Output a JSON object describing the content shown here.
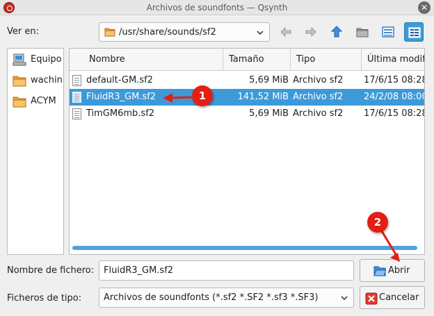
{
  "window": {
    "title": "Archivos de soundfonts — Qsynth",
    "close_glyph": "✕"
  },
  "look_in": {
    "label": "Ver en:",
    "path": "/usr/share/sounds/sf2"
  },
  "toolbar": {
    "buttons": [
      {
        "name": "back-button",
        "icon": "arrow-left-icon",
        "enabled": false
      },
      {
        "name": "forward-button",
        "icon": "arrow-right-icon",
        "enabled": false
      },
      {
        "name": "parent-directory-button",
        "icon": "arrow-up-icon",
        "enabled": true
      },
      {
        "name": "new-folder-button",
        "icon": "new-folder-icon",
        "enabled": true
      },
      {
        "name": "list-view-button",
        "icon": "list-view-icon",
        "enabled": true
      },
      {
        "name": "detail-view-button",
        "icon": "detail-view-icon",
        "enabled": true,
        "active": true
      }
    ]
  },
  "sidebar": {
    "items": [
      {
        "label": "Equipo",
        "icon": "computer-icon"
      },
      {
        "label": "wachin",
        "icon": "folder-icon"
      },
      {
        "label": "ACYM",
        "icon": "folder-icon"
      }
    ]
  },
  "file_list": {
    "columns": [
      "Nombre",
      "Tamaño",
      "Tipo",
      "Última modificación"
    ],
    "rows": [
      {
        "name": "default-GM.sf2",
        "size": "5,69 MiB",
        "type": "Archivo sf2",
        "modified": "17/6/15 08:28",
        "selected": false
      },
      {
        "name": "FluidR3_GM.sf2",
        "size": "141,52 MiB",
        "type": "Archivo sf2",
        "modified": "24/2/08 08:00",
        "selected": true
      },
      {
        "name": "TimGM6mb.sf2",
        "size": "5,69 MiB",
        "type": "Archivo sf2",
        "modified": "17/6/15 08:28",
        "selected": false
      }
    ]
  },
  "filename": {
    "label": "Nombre de fichero:",
    "value": "FluidR3_GM.sf2"
  },
  "filetype": {
    "label": "Ficheros de tipo:",
    "value": "Archivos de soundfonts (*.sf2 *.SF2 *.sf3 *.SF3)"
  },
  "buttons": {
    "open_label": "Abrir",
    "cancel_label": "Cancelar"
  },
  "annotations": [
    {
      "number": "1",
      "target": "FluidR3_GM.sf2 row"
    },
    {
      "number": "2",
      "target": "Abrir button"
    }
  ],
  "colors": {
    "accent": "#3d9ad9",
    "annotation": "#e41e13",
    "folder": "#f0a63a"
  }
}
